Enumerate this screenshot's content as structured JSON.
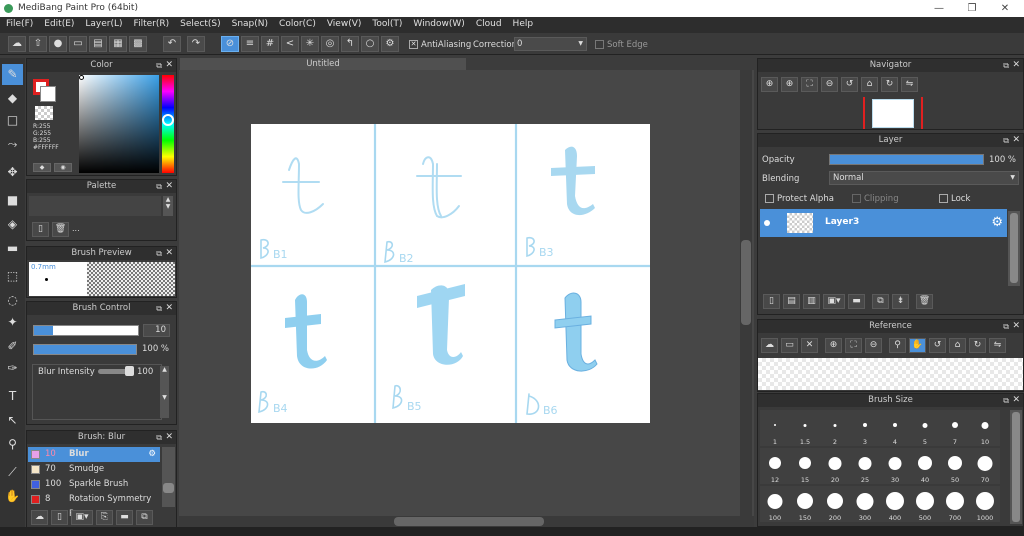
{
  "app": {
    "title": "MediBang Paint Pro (64bit)"
  },
  "menu": [
    "File(F)",
    "Edit(E)",
    "Layer(L)",
    "Filter(R)",
    "Select(S)",
    "Snap(N)",
    "Color(C)",
    "View(V)",
    "Tool(T)",
    "Window(W)",
    "Cloud",
    "Help"
  ],
  "toolbar": {
    "antialias_label": "AntiAliasing",
    "correction_label": "Correction",
    "correction_value": "0",
    "soft_edge_label": "Soft Edge"
  },
  "color_panel": {
    "title": "Color",
    "rgb_text": "R:255\nG:255\nB:255\n#FFFFFF",
    "r": "R:255",
    "g": "G:255",
    "b": "B:255",
    "hex": "#FFFFFF"
  },
  "palette_panel": {
    "title": "Palette"
  },
  "brush_preview": {
    "title": "Brush Preview",
    "size": "0.7mm"
  },
  "brush_control": {
    "title": "Brush Control",
    "size": "10",
    "opacity": "100 %",
    "blur_label": "Blur Intensity",
    "blur_value": "100"
  },
  "brush_list": {
    "title": "Brush: Blur",
    "items": [
      {
        "size": "10",
        "name": "Blur",
        "color": "#e8a0e8"
      },
      {
        "size": "70",
        "name": "Smudge",
        "color": "#f5e6c8"
      },
      {
        "size": "100",
        "name": "Sparkle Brush",
        "color": "#4060e0"
      },
      {
        "size": "8",
        "name": "Rotation Symmetry Pe",
        "color": "#e02020"
      }
    ]
  },
  "document": {
    "tab": "Untitled",
    "labels": [
      "B1",
      "B2",
      "B3",
      "B4",
      "B5",
      "B6"
    ]
  },
  "navigator": {
    "title": "Navigator"
  },
  "layer_panel": {
    "title": "Layer",
    "opacity_label": "Opacity",
    "opacity_value": "100 %",
    "blending_label": "Blending",
    "blending_value": "Normal",
    "protect_alpha": "Protect Alpha",
    "clipping": "Clipping",
    "lock": "Lock",
    "layer_name": "Layer3"
  },
  "reference_panel": {
    "title": "Reference"
  },
  "brush_size_panel": {
    "title": "Brush Size",
    "sizes": [
      "1",
      "1.5",
      "2",
      "3",
      "4",
      "5",
      "7",
      "10",
      "12",
      "15",
      "20",
      "25",
      "30",
      "40",
      "50",
      "70",
      "100",
      "150",
      "200",
      "300",
      "400",
      "500",
      "700",
      "1000"
    ]
  },
  "colors": {
    "accent": "#4a90d9",
    "stroke": "#a8d8f0"
  }
}
